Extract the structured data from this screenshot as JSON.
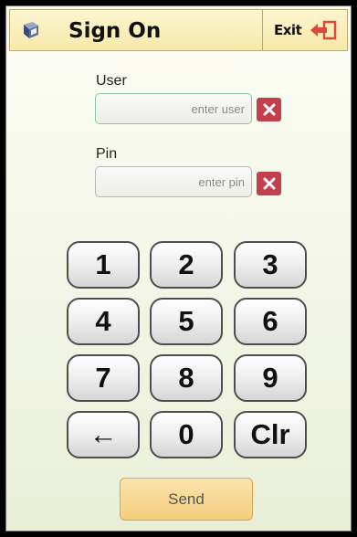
{
  "header": {
    "title": "Sign On",
    "exit_label": "Exit",
    "app_icon": "book-icon",
    "exit_icon": "exit-arrow-icon"
  },
  "form": {
    "user_label": "User",
    "user_placeholder": "enter user",
    "user_value": "",
    "pin_label": "Pin",
    "pin_placeholder": "enter pin",
    "pin_value": "",
    "clear_icon": "close-icon"
  },
  "keypad": {
    "keys": [
      "1",
      "2",
      "3",
      "4",
      "5",
      "6",
      "7",
      "8",
      "9",
      "←",
      "0",
      "Clr"
    ]
  },
  "send_label": "Send",
  "colors": {
    "title_bar": "#f6e9a9",
    "clear_button": "#c2404d",
    "exit_icon": "#e0483c",
    "send_button": "#f3cd7b",
    "user_focus_border": "#86c7a1"
  }
}
